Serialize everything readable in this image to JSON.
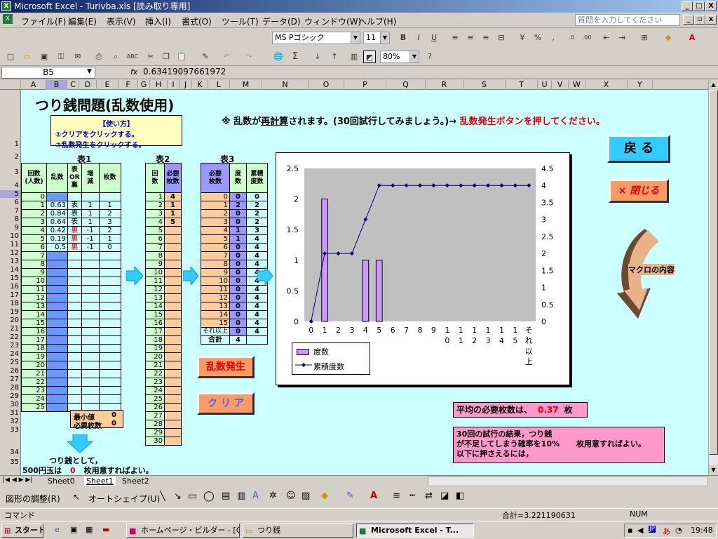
{
  "window": {
    "title": "Microsoft Excel - Turivba.xls  [読み取り専用]",
    "min": "_",
    "max": "□",
    "close": "X"
  },
  "menu": {
    "items": [
      "ファイル(F)",
      "編集(E)",
      "表示(V)",
      "挿入(I)",
      "書式(O)",
      "ツール(T)",
      "データ(D)",
      "ウィンドウ(W)",
      "ヘルプ(H)"
    ],
    "ask": "質問を入力してください"
  },
  "toolbar": {
    "font": "MS Pゴシック",
    "size": "11",
    "zoom": "80%"
  },
  "formula": {
    "cell": "B5",
    "fx": "fx",
    "value": "0.63419097661972"
  },
  "colors": {
    "sheet_bg": "#ccffff",
    "col_b": "#6699ff",
    "orange": "#ffcc99",
    "purple_col": "#9999ff",
    "chart_bar": "#cc99ff",
    "title_bar": "#0a246a"
  },
  "columns": [
    "A",
    "B",
    "C",
    "D",
    "E",
    "F",
    "G",
    "H",
    "I",
    "J",
    "K",
    "L",
    "M",
    "N",
    "O",
    "P",
    "Q",
    "R",
    "S",
    "T",
    "U",
    "V",
    "W",
    "X",
    "Y"
  ],
  "rows": [
    "1",
    "2",
    "3",
    "4",
    "5",
    "6",
    "7",
    "8",
    "9",
    "10",
    "11",
    "12",
    "13",
    "14",
    "15",
    "16",
    "17",
    "18",
    "19",
    "20",
    "21",
    "22",
    "23",
    "24",
    "25",
    "26",
    "27",
    "28",
    "29",
    "30",
    "31",
    "32",
    "33",
    "34",
    "35"
  ],
  "sheet": {
    "title": "つり銭問題(乱数使用)",
    "howto": {
      "header": "【使い方】",
      "step1": "①クリアをクリックする。",
      "step2": "②乱数発生をクリックする。"
    },
    "instruction_a": "※ 乱数が",
    "instruction_b": "再計算",
    "instruction_c": "されます。(30回試行してみましょう。)→ ",
    "instruction_d": "乱数発生ボタンを押してください。",
    "t1_label": "表1",
    "t2_label": "表2",
    "t3_label": "表3",
    "t1_headers": [
      "回数\n(人数)",
      "乱数",
      "表\nOR\n裏",
      "増\n減",
      "枚数"
    ],
    "t1_rows": [
      [
        "0",
        "",
        "",
        "",
        ""
      ],
      [
        "1",
        "0.63",
        "表",
        "1",
        "1"
      ],
      [
        "2",
        "0.84",
        "表",
        "1",
        "2"
      ],
      [
        "3",
        "0.64",
        "表",
        "1",
        "3"
      ],
      [
        "4",
        "0.42",
        "裏",
        "-1",
        "2"
      ],
      [
        "5",
        "0.19",
        "裏",
        "-1",
        "1"
      ],
      [
        "6",
        "0.5",
        "裏",
        "-1",
        "0"
      ],
      [
        "7",
        "",
        "",
        "",
        ""
      ],
      [
        "8",
        "",
        "",
        "",
        ""
      ],
      [
        "9",
        "",
        "",
        "",
        ""
      ],
      [
        "10",
        "",
        "",
        "",
        ""
      ],
      [
        "11",
        "",
        "",
        "",
        ""
      ],
      [
        "12",
        "",
        "",
        "",
        ""
      ],
      [
        "13",
        "",
        "",
        "",
        ""
      ],
      [
        "14",
        "",
        "",
        "",
        ""
      ],
      [
        "15",
        "",
        "",
        "",
        ""
      ],
      [
        "16",
        "",
        "",
        "",
        ""
      ],
      [
        "17",
        "",
        "",
        "",
        ""
      ],
      [
        "18",
        "",
        "",
        "",
        ""
      ],
      [
        "19",
        "",
        "",
        "",
        ""
      ],
      [
        "20",
        "",
        "",
        "",
        ""
      ],
      [
        "21",
        "",
        "",
        "",
        ""
      ],
      [
        "22",
        "",
        "",
        "",
        ""
      ],
      [
        "23",
        "",
        "",
        "",
        ""
      ],
      [
        "24",
        "",
        "",
        "",
        ""
      ],
      [
        "25",
        "",
        "",
        "",
        ""
      ]
    ],
    "t1_min_label": "最小値",
    "t1_min": "0",
    "t1_need_label": "必要枚数",
    "t1_need": "0",
    "t2_headers": [
      "回\n数",
      "必要\n枚数"
    ],
    "t2_rows": [
      [
        "1",
        "4"
      ],
      [
        "2",
        "1"
      ],
      [
        "3",
        "1"
      ],
      [
        "4",
        "5"
      ],
      [
        "5",
        ""
      ],
      [
        "6",
        ""
      ],
      [
        "7",
        ""
      ],
      [
        "8",
        ""
      ],
      [
        "9",
        ""
      ],
      [
        "10",
        ""
      ],
      [
        "11",
        ""
      ],
      [
        "12",
        ""
      ],
      [
        "13",
        ""
      ],
      [
        "14",
        ""
      ],
      [
        "15",
        ""
      ],
      [
        "16",
        ""
      ],
      [
        "17",
        ""
      ],
      [
        "18",
        ""
      ],
      [
        "19",
        ""
      ],
      [
        "20",
        ""
      ],
      [
        "21",
        ""
      ],
      [
        "22",
        ""
      ],
      [
        "23",
        ""
      ],
      [
        "24",
        ""
      ],
      [
        "25",
        ""
      ],
      [
        "26",
        ""
      ],
      [
        "27",
        ""
      ],
      [
        "28",
        ""
      ],
      [
        "29",
        ""
      ],
      [
        "30",
        ""
      ]
    ],
    "t3_headers": [
      "必要\n枚数",
      "度\n数",
      "累積\n度数"
    ],
    "t3_rows": [
      [
        "0",
        "0",
        "0"
      ],
      [
        "1",
        "2",
        "2"
      ],
      [
        "2",
        "0",
        "2"
      ],
      [
        "3",
        "0",
        "2"
      ],
      [
        "4",
        "1",
        "3"
      ],
      [
        "5",
        "1",
        "4"
      ],
      [
        "6",
        "0",
        "4"
      ],
      [
        "7",
        "0",
        "4"
      ],
      [
        "8",
        "0",
        "4"
      ],
      [
        "9",
        "0",
        "4"
      ],
      [
        "10",
        "0",
        "4"
      ],
      [
        "11",
        "0",
        "4"
      ],
      [
        "12",
        "0",
        "4"
      ],
      [
        "13",
        "0",
        "4"
      ],
      [
        "14",
        "0",
        "4"
      ],
      [
        "15",
        "0",
        "4"
      ],
      [
        "それ以上",
        "0",
        "4"
      ]
    ],
    "t3_total_label": "合計",
    "t3_total": "4",
    "btn_random": "乱数発生",
    "btn_clear": "ク リ ア",
    "btn_back": "戻 る",
    "btn_close": "× 閉じる",
    "macro_label": "マクロの内容",
    "avg_a": "平均の必要枚数は、",
    "avg_value": "0.37",
    "avg_b": "枚",
    "result_a": "30回の試行の結果，つり銭",
    "result_b": "が不足してしまう確率を10%",
    "result_c": "枚用意すればよい。",
    "result_d": "以下に押さえるには，",
    "bottom_a": "つり銭として，",
    "bottom_b": "500円玉は",
    "bottom_value": "0",
    "bottom_c": "枚用意すればよい。"
  },
  "chart_data": {
    "type": "bar",
    "categories": [
      "0",
      "1",
      "2",
      "3",
      "4",
      "5",
      "6",
      "7",
      "8",
      "9",
      "10",
      "11",
      "12",
      "13",
      "14",
      "15",
      "それ以上"
    ],
    "series": [
      {
        "name": "度数",
        "type": "bar",
        "axis": "left",
        "values": [
          0,
          2,
          0,
          0,
          1,
          1,
          0,
          0,
          0,
          0,
          0,
          0,
          0,
          0,
          0,
          0,
          0
        ]
      },
      {
        "name": "累積度数",
        "type": "line",
        "axis": "right",
        "values": [
          0,
          2,
          2,
          2,
          3,
          4,
          4,
          4,
          4,
          4,
          4,
          4,
          4,
          4,
          4,
          4,
          4
        ]
      }
    ],
    "yticks_left": [
      "0",
      "0.5",
      "1",
      "1.5",
      "2",
      "2.5"
    ],
    "yticks_right": [
      "0",
      "0.5",
      "1",
      "1.5",
      "2",
      "2.5",
      "3",
      "3.5",
      "4",
      "4.5"
    ],
    "ylim_left": [
      0,
      2.5
    ],
    "ylim_right": [
      0,
      4.5
    ],
    "legend": "bottom-left",
    "grid": false
  },
  "tabs": [
    "Sheet0",
    "Sheet1",
    "Sheet2"
  ],
  "draw": {
    "adjust": "図形の調整(R)",
    "autoshape": "オートシェイプ(U)"
  },
  "status": {
    "mode": "コマンド",
    "sum": "合計=3.221190631",
    "num": "NUM"
  },
  "taskbar": {
    "start": "スタート",
    "tasks": [
      "ホームページ・ビルダー - [O...",
      "つり銭",
      "Microsoft Excel - T..."
    ],
    "time": "19:48",
    "ime": "JP"
  }
}
